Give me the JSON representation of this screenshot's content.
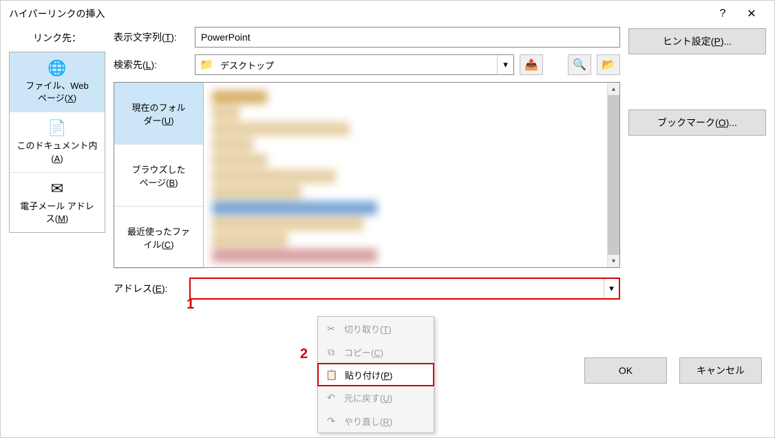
{
  "title": "ハイパーリンクの挿入",
  "titlebar": {
    "help": "?",
    "close": "✕"
  },
  "linkto": {
    "label": "リンク先：",
    "items": [
      {
        "icon": "🌐",
        "line1": "ファイル、Web",
        "line2": "ページ(",
        "key": "X",
        "line3": ")"
      },
      {
        "icon": "📄",
        "line1": "このドキュメント内",
        "line2": "(",
        "key": "A",
        "line3": ")"
      },
      {
        "icon": "✉",
        "line1": "電子メール アドレ",
        "line2": "ス(",
        "key": "M",
        "line3": ")"
      }
    ]
  },
  "display": {
    "label_pre": "表示文字列(",
    "key": "T",
    "label_post": "):",
    "value": "PowerPoint"
  },
  "hint": {
    "label_pre": "ヒント設定(",
    "key": "P",
    "label_post": ")..."
  },
  "bookmark": {
    "label_pre": "ブックマーク(",
    "key": "O",
    "label_post": ")..."
  },
  "search": {
    "label_pre": "検索先(",
    "key": "L",
    "label_post": "):",
    "selected": "デスクトップ",
    "folder_icon": "📁"
  },
  "browse_tabs": [
    {
      "pre": "現在のフォル",
      "pre2": "ダー(",
      "key": "U",
      "post": ")"
    },
    {
      "pre": "ブラウズした",
      "pre2": "ページ(",
      "key": "B",
      "post": ")"
    },
    {
      "pre": "最近使ったファ",
      "pre2": "イル(",
      "key": "C",
      "post": ")"
    }
  ],
  "address": {
    "label_pre": "アドレス(",
    "key": "E",
    "label_post": "):",
    "value": ""
  },
  "annotations": {
    "a1": "1",
    "a2": "2"
  },
  "context_menu": [
    {
      "icon": "✂",
      "pre": "切り取り(",
      "key": "T",
      "post": ")",
      "enabled": false
    },
    {
      "icon": "⧉",
      "pre": "コピー(",
      "key": "C",
      "post": ")",
      "enabled": false
    },
    {
      "icon": "📋",
      "pre": "貼り付け(",
      "key": "P",
      "post": ")",
      "enabled": true,
      "highlighted": true
    },
    {
      "icon": "↶",
      "pre": "元に戻す(",
      "key": "U",
      "post": ")",
      "enabled": false
    },
    {
      "icon": "↷",
      "pre": "やり直し(",
      "key": "R",
      "post": ")",
      "enabled": false
    }
  ],
  "footer": {
    "ok": "OK",
    "cancel": "キャンセル"
  },
  "iconbtns": {
    "up": "📤",
    "web": "🔍",
    "open": "📂"
  }
}
